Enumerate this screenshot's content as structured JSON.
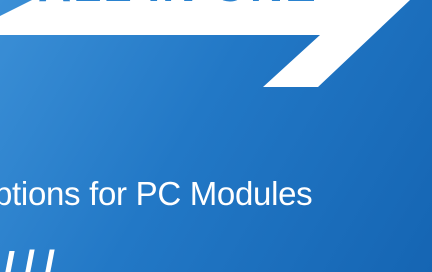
{
  "banner": {
    "headline": "ALL IN ONE",
    "subtitle": "ptions for PC Modules",
    "tagline": "I                 l     l"
  },
  "colors": {
    "background_light": "#3b8fd6",
    "background_dark": "#1565b3",
    "shape": "#ffffff",
    "headline_text": "#2a82cf",
    "body_text": "#ffffff"
  }
}
